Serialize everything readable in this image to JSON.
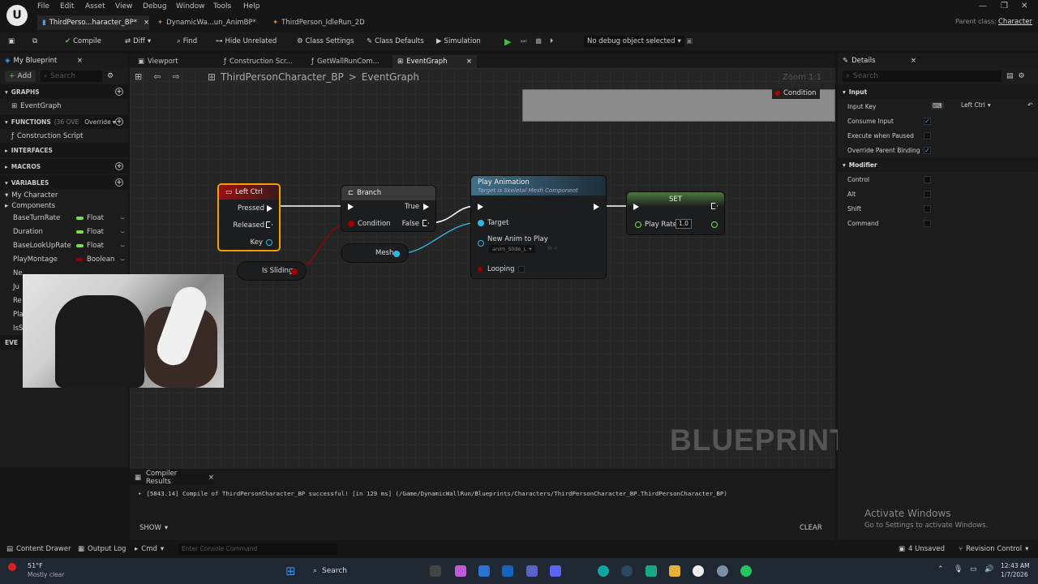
{
  "topbar": {
    "menu": [
      "File",
      "Edit",
      "Asset",
      "View",
      "Debug",
      "Window",
      "Tools",
      "Help"
    ],
    "tabs": [
      "ThirdPerso...haracter_BP*",
      "DynamicWa...un_AnimBP*",
      "ThirdPerson_IdleRun_2D"
    ],
    "parent_class_label": "Parent class:",
    "parent_class_value": "Character"
  },
  "toolbar": {
    "compile": "Compile",
    "diff": "Diff",
    "find": "Find",
    "hide_unrelated": "Hide Unrelated",
    "class_settings": "Class Settings",
    "class_defaults": "Class Defaults",
    "simulation": "Simulation",
    "debug_object": "No debug object selected"
  },
  "my_blueprint": {
    "title": "My Blueprint",
    "add": "Add",
    "search_placeholder": "Search",
    "graphs_label": "GRAPHS",
    "event_graph": "EventGraph",
    "functions_label": "FUNCTIONS",
    "functions_count": "(36 OVE",
    "override": "Override",
    "construction_script": "Construction Script",
    "interfaces_label": "INTERFACES",
    "macros_label": "MACROS",
    "variables_label": "VARIABLES",
    "my_character": "My Character",
    "components": "Components",
    "variables": [
      {
        "name": "BaseTurnRate",
        "type": "Float",
        "color": "#7ee048"
      },
      {
        "name": "Duration",
        "type": "Float",
        "color": "#7ee048"
      },
      {
        "name": "BaseLookUpRate",
        "type": "Float",
        "color": "#7ee048"
      },
      {
        "name": "PlayMontage",
        "type": "Boolean",
        "color": "#8c0000"
      }
    ],
    "partial_rows": [
      "Ne",
      "Ju",
      "Re",
      "Pla",
      "IsS"
    ],
    "event_dispatchers": "EVE"
  },
  "graph_tabs": [
    "Viewport",
    "Construction Scr...",
    "GetWallRunCom...",
    "EventGraph"
  ],
  "breadcrumb": {
    "root": "ThirdPersonCharacter_BP",
    "sep": ">",
    "current": "EventGraph"
  },
  "zoom": "Zoom 1:1",
  "comment_condition": "Condition",
  "nodes": {
    "left_ctrl": {
      "title": "Left Ctrl",
      "pressed": "Pressed",
      "released": "Released",
      "key": "Key"
    },
    "branch": {
      "title": "Branch",
      "true": "True",
      "false": "False",
      "condition": "Condition"
    },
    "play_anim": {
      "title": "Play Animation",
      "subtitle": "Target is Skeletal Mesh Component",
      "target": "Target",
      "new_anim": "New Anim to Play",
      "asset": "anim_Slide_L",
      "looping": "Looping"
    },
    "set": {
      "title": "SET",
      "play_rate": "Play Rate",
      "value": "1.0"
    },
    "mesh": "Mesh",
    "is_sliding": "Is Sliding"
  },
  "watermark": "BLUEPRINT",
  "details": {
    "title": "Details",
    "search_placeholder": "Search",
    "input_section": "Input",
    "rows": [
      {
        "label": "Input Key",
        "value": "Left Ctrl"
      },
      {
        "label": "Consume Input",
        "checked": true
      },
      {
        "label": "Execute when Paused",
        "checked": false
      },
      {
        "label": "Override Parent Binding",
        "checked": true
      }
    ],
    "modifier_section": "Modifier",
    "modifiers": [
      "Control",
      "Alt",
      "Shift",
      "Command"
    ]
  },
  "compiler": {
    "title": "Compiler Results",
    "message": "[5843.14] Compile of ThirdPersonCharacter_BP successful! [in 129 ms] (/Game/DynamicWallRun/Blueprints/Characters/ThirdPersonCharacter_BP.ThirdPersonCharacter_BP)",
    "show": "SHOW",
    "clear": "CLEAR"
  },
  "activate": {
    "title": "Activate Windows",
    "sub": "Go to Settings to activate Windows."
  },
  "bottombar": {
    "content_drawer": "Content Drawer",
    "output_log": "Output Log",
    "cmd": "Cmd",
    "console_placeholder": "Enter Console Command",
    "unsaved": "4 Unsaved",
    "revision": "Revision Control"
  },
  "taskbar": {
    "weather_temp": "51°F",
    "weather_desc": "Mostly clear",
    "search": "Search",
    "time": "12:43 AM",
    "date": "1/7/2026"
  }
}
